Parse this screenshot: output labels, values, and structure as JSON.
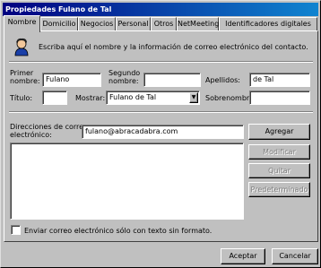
{
  "window": {
    "title": "Propiedades Fulano de Tal"
  },
  "tabs": [
    {
      "label": "Nombre",
      "active": true
    },
    {
      "label": "Domicilio"
    },
    {
      "label": "Negocios"
    },
    {
      "label": "Personal"
    },
    {
      "label": "Otros"
    },
    {
      "label": "NetMeeting"
    },
    {
      "label": "Identificadores digitales"
    }
  ],
  "header": {
    "icon": "contact-person-icon",
    "instruction": "Escriba aquí el nombre y la información de correo electrónico del contacto."
  },
  "form": {
    "primer_nombre_label_1": "Primer",
    "primer_nombre_label_2": "nombre:",
    "primer_nombre_value": "Fulano",
    "segundo_nombre_label_1": "Segundo",
    "segundo_nombre_label_2": "nombre:",
    "segundo_nombre_value": "",
    "apellidos_label": "Apellidos:",
    "apellidos_value": "de Tal",
    "titulo_label": "Título:",
    "titulo_value": "",
    "mostrar_label": "Mostrar:",
    "mostrar_value": "Fulano de Tal",
    "sobrenombre_label": "Sobrenombre:",
    "sobrenombre_value": ""
  },
  "email": {
    "label_1": "Direcciones de correo",
    "label_2": "electrónico:",
    "input_value": "fulano@abracadabra.com",
    "list": []
  },
  "buttons": {
    "agregar": "Agregar",
    "modificar": "Modificar",
    "quitar": "Quitar",
    "predeterminado": "Predeterminado",
    "aceptar": "Aceptar",
    "cancelar": "Cancelar"
  },
  "plain_text_checkbox": {
    "label": "Enviar correo electrónico sólo con texto sin formato.",
    "checked": false
  }
}
